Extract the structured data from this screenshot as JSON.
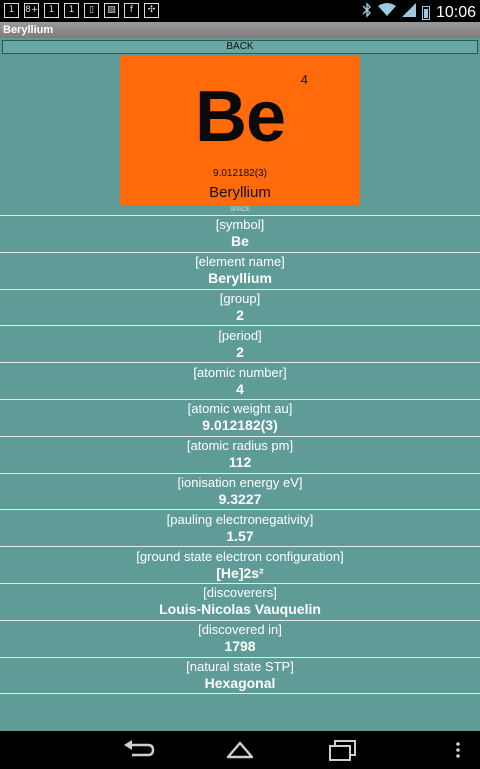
{
  "status_bar": {
    "left_icons": [
      "1",
      "8+",
      "1",
      "1",
      "▯",
      "▨",
      "f",
      "✣"
    ],
    "time": "10:06"
  },
  "title_bar": {
    "title": "Beryllium"
  },
  "back_button": {
    "label": "BACK"
  },
  "tile": {
    "atomic_number": "4",
    "symbol": "Be",
    "weight": "9.012182(3)",
    "name": "Beryllium",
    "caption": "SPACE",
    "color": "#ff6b0a"
  },
  "properties": [
    {
      "label": "[symbol]",
      "value": "Be"
    },
    {
      "label": "[element name]",
      "value": "Beryllium"
    },
    {
      "label": "[group]",
      "value": "2"
    },
    {
      "label": "[period]",
      "value": "2"
    },
    {
      "label": "[atomic number]",
      "value": "4"
    },
    {
      "label": "[atomic weight au]",
      "value": "9.012182(3)"
    },
    {
      "label": "[atomic radius pm]",
      "value": "112"
    },
    {
      "label": "[ionisation energy eV]",
      "value": "9.3227"
    },
    {
      "label": "[pauling electronegativity]",
      "value": "1.57"
    },
    {
      "label": "[ground state electron configuration]",
      "value": "[He]2s²"
    },
    {
      "label": "[discoverers]",
      "value": "Louis-Nicolas Vauquelin"
    },
    {
      "label": "[discovered in]",
      "value": "1798"
    },
    {
      "label": "[natural state STP]",
      "value": "Hexagonal"
    }
  ],
  "colors": {
    "background": "#5f9c98",
    "tile": "#ff6b0a",
    "divider": "#d9ecea"
  },
  "nav_icons": [
    "back-icon",
    "home-icon",
    "recent-apps-icon",
    "menu-icon"
  ]
}
